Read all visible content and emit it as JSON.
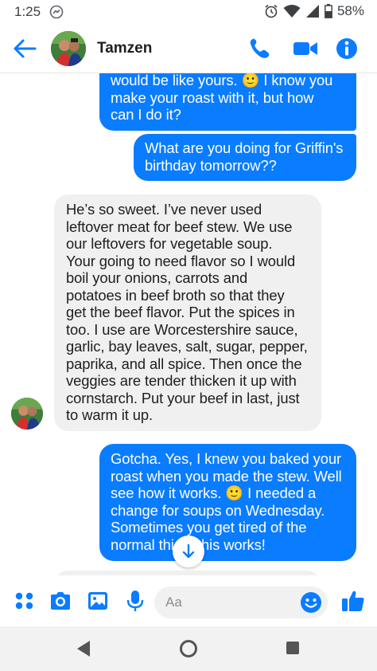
{
  "status_bar": {
    "time": "1:25",
    "battery": "58%",
    "icons": [
      "messenger-notification-icon",
      "alarm-icon",
      "wifi-icon",
      "signal-icon",
      "battery-icon"
    ]
  },
  "header": {
    "contact_name": "Tamzen",
    "icons": [
      "back-arrow-icon",
      "phone-icon",
      "video-camera-icon",
      "info-icon"
    ]
  },
  "messages": [
    {
      "direction": "out",
      "text": "would be like yours. 🙂 I know you\nmake your roast with it, but how\ncan I do it?"
    },
    {
      "direction": "out",
      "text": "What are you doing for Griffin's\nbirthday tomorrow??"
    },
    {
      "direction": "in",
      "text": "He’s so sweet. I’ve never used\nleftover meat for beef stew. We use\nour leftovers for vegetable soup.\nYour going to need flavor so I would\nboil your onions, carrots and\npotatoes in beef broth so that they\nget the beef flavor. Put the spices in\ntoo.  I use are Worcestershire sauce,\ngarlic, bay leaves, salt, sugar, pepper,\npaprika, and all spice. Then once the\nveggies are tender thicken it up with\ncornstarch. Put your beef in last, just\nto warm it up."
    },
    {
      "direction": "out",
      "text": "Gotcha. Yes, I knew you baked your\nroast when you made the stew. Well\nsee how it works. 🙂 I needed a\nchange for soups on Wednesday.\nSometimes you get tired of the\nnormal thi      so this works!"
    }
  ],
  "compose": {
    "placeholder": "Aa",
    "icons": [
      "apps-grid-icon",
      "camera-icon",
      "gallery-icon",
      "microphone-icon",
      "emoji-icon",
      "thumbs-up-icon"
    ]
  },
  "nav": {
    "icons": [
      "back-triangle-icon",
      "home-circle-icon",
      "recents-square-icon"
    ]
  },
  "colors": {
    "accent": "#0a7cff",
    "incoming_bubble": "#f1f0f0",
    "header_text": "#1c1e21"
  }
}
